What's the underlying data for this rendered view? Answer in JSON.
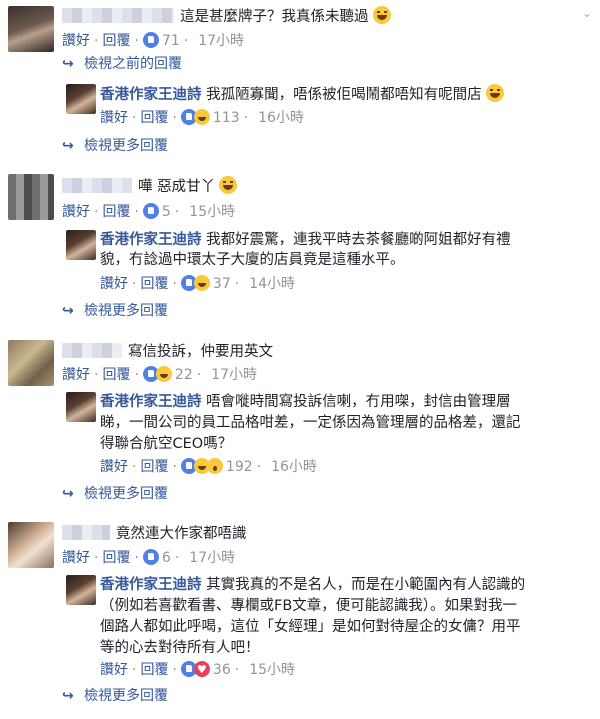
{
  "labels": {
    "like": "讚好",
    "reply": "回覆",
    "view_previous": "檢視之前的回覆",
    "view_more": "檢視更多回覆"
  },
  "threads": [
    {
      "comment": {
        "text": "這是甚麼牌子？我真係未聽過",
        "reactions": "71",
        "time": "17小時"
      },
      "reply": {
        "author": "香港作家王迪詩",
        "lines": [
          "我孤陋寡聞，唔係被佢喝鬧都唔知有呢間店"
        ],
        "reactions": "113",
        "time": "16小時"
      }
    },
    {
      "comment": {
        "text": "嘩 惡成甘丫",
        "reactions": "5",
        "time": "15小時"
      },
      "reply": {
        "author": "香港作家王迪詩",
        "lines": [
          "我都好震驚，連我平時去茶餐廳啲阿姐都好有禮",
          "貌，冇諗過中環太子大廈的店員竟是這種水平。"
        ],
        "reactions": "37",
        "time": "14小時"
      }
    },
    {
      "comment": {
        "text": "寫信投訴，仲要用英文",
        "reactions": "22",
        "time": "17小時"
      },
      "reply": {
        "author": "香港作家王迪詩",
        "lines": [
          "唔會嘥時間寫投訴信喇，冇用㗎，封信由管理層",
          "睇，一間公司的員工品格咁差，一定係因為管理層的品格差，還記",
          "得聯合航空CEO嗎？"
        ],
        "reactions": "192",
        "time": "16小時"
      }
    },
    {
      "comment": {
        "text": "竟然連大作家都唔識",
        "reactions": "6",
        "time": "17小時"
      },
      "reply": {
        "author": "香港作家王迪詩",
        "lines": [
          "其實我真的不是名人，而是在小範圍內有人認識的",
          "（例如若喜歡看書、專欄或FB文章，便可能認識我）。如果對我一",
          "個路人都如此呼喝，這位「女經理」是如何對待屋企的女傭？用平",
          "等的心去對待所有人吧！"
        ],
        "reactions": "36",
        "time": "15小時"
      }
    }
  ]
}
